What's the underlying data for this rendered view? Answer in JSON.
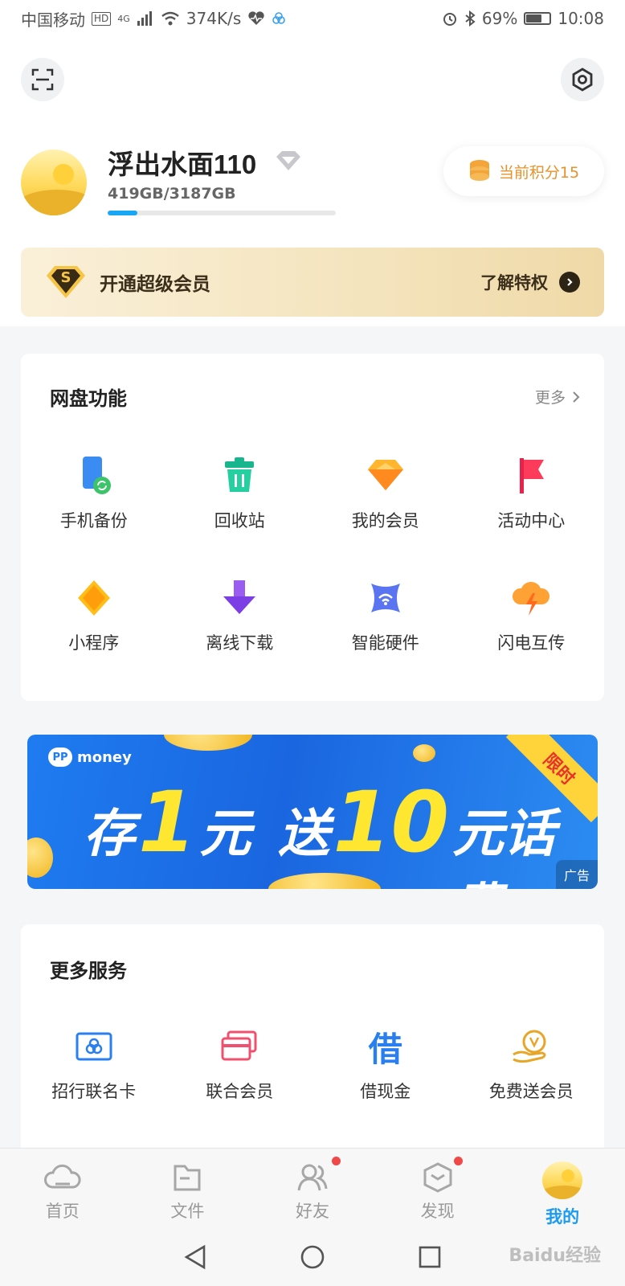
{
  "status_bar": {
    "carrier": "中国移动",
    "hd": "HD",
    "network": "4G",
    "speed": "374K/s",
    "battery": "69%",
    "battery_fraction": 0.69,
    "time": "10:08"
  },
  "profile": {
    "username": "浮出水面110",
    "storage": "419GB/3187GB",
    "storage_used_fraction": 0.1315,
    "points_label": "当前积分15"
  },
  "vip_banner": {
    "badge": "S",
    "title": "开通超级会员",
    "action": "了解特权"
  },
  "disk_features": {
    "title": "网盘功能",
    "more": "更多",
    "items": [
      {
        "label": "手机备份",
        "icon": "phone-backup-icon"
      },
      {
        "label": "回收站",
        "icon": "recycle-bin-icon"
      },
      {
        "label": "我的会员",
        "icon": "diamond-icon"
      },
      {
        "label": "活动中心",
        "icon": "flag-icon"
      },
      {
        "label": "小程序",
        "icon": "mini-program-icon"
      },
      {
        "label": "离线下载",
        "icon": "download-arrow-icon"
      },
      {
        "label": "智能硬件",
        "icon": "smart-hardware-icon"
      },
      {
        "label": "闪电互传",
        "icon": "lightning-cloud-icon"
      }
    ]
  },
  "ad": {
    "brand": "money",
    "brand_badge": "PP",
    "headline_w1": "存",
    "headline_n1": "1",
    "headline_w2": "元",
    "headline_w3": "送",
    "headline_n2": "10",
    "headline_w4": "元话费",
    "ribbon": "限时",
    "tag": "广告"
  },
  "more_services": {
    "title": "更多服务",
    "items": [
      {
        "label": "招行联名卡",
        "icon": "bank-card-icon"
      },
      {
        "label": "联合会员",
        "icon": "member-card-icon"
      },
      {
        "label": "借现金",
        "icon": "borrow-icon",
        "glyph": "借"
      },
      {
        "label": "免费送会员",
        "icon": "free-vip-icon"
      }
    ]
  },
  "bottom_nav": {
    "items": [
      {
        "label": "首页"
      },
      {
        "label": "文件"
      },
      {
        "label": "好友"
      },
      {
        "label": "发现"
      },
      {
        "label": "我的"
      }
    ]
  },
  "watermark": "Baidu经验",
  "colors": {
    "accent": "#1d9bf0",
    "points": "#e8912a",
    "gold": "#f4e4bd",
    "badge_red": "#f04848"
  }
}
